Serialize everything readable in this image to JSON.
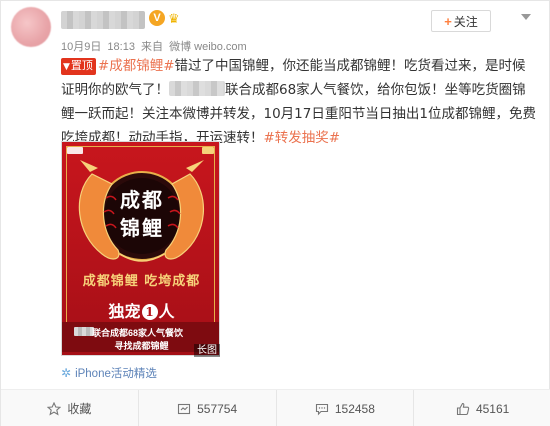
{
  "header": {
    "date": "10月9日",
    "time": "18:13",
    "via_label": "来自",
    "source_site": "微博 weibo.com",
    "follow_label": "关注",
    "follow_plus": "+"
  },
  "post": {
    "pin_label": "置顶",
    "hashtag_koi": "#成都锦鲤#",
    "text_part1": "错过了中国锦鲤，你还能当成都锦鲤！吃货看过来，是时候证明你的欧气了！",
    "text_part2": "联合成都68家人气餐饮，给你包饭！坐等吃货圈锦鲤一跃而起！关注本微博并转发，10月17日重阳节当日抽出1位成都锦鲤，免费吃垮成都！动动手指，开运速转！",
    "hashtag_lottery": "#转发抽奖#"
  },
  "poster": {
    "title_line1": "成都",
    "title_line2": "锦鲤",
    "line1": "成都锦鲤 吃垮成都",
    "line2_pre": "独宠",
    "line2_num": "1",
    "line2_post": "人",
    "footer1": "联合成都68家人气餐饮",
    "footer2": "寻找成都锦鲤",
    "long_image_badge": "长图"
  },
  "source": {
    "label": "iPhone活动精选",
    "icon": "sparkle-icon"
  },
  "actions": {
    "favorite": "收藏",
    "repost_count": "557754",
    "comment_count": "152458",
    "like_count": "45161"
  },
  "colors": {
    "hashtag": "#eb7350",
    "pin": "#e2341d",
    "poster_red": "#b5121a",
    "source_link": "#5d83b8"
  }
}
